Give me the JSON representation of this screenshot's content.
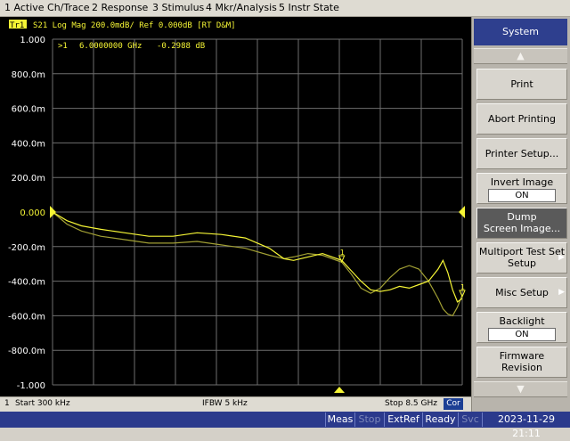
{
  "menu": {
    "items": [
      "1 Active Ch/Trace",
      "2 Response",
      "3 Stimulus",
      "4 Mkr/Analysis",
      "5 Instr State"
    ]
  },
  "trace_header": {
    "trace_badge": "Tr1",
    "text": "S21 Log Mag 200.0mdB/ Ref 0.000dB [RT D&M]"
  },
  "marker_readout": {
    "marker": ">1",
    "frequency": "6.0000000 GHz",
    "value": "-0.2988 dB"
  },
  "chart_data": {
    "type": "line",
    "title": "",
    "xlabel": "",
    "ylabel": "",
    "x_unit": "GHz",
    "xlim": [
      0.0003,
      8.5
    ],
    "ylim": [
      -1.0,
      1.0
    ],
    "y_unit": "dB",
    "grid": true,
    "y_tick_labels": [
      "1.000",
      "800.0m",
      "600.0m",
      "400.0m",
      "200.0m",
      "0.000",
      "-200.0m",
      "-400.0m",
      "-600.0m",
      "-800.0m",
      "-1.000"
    ],
    "y_ticks": [
      1.0,
      0.8,
      0.6,
      0.4,
      0.2,
      0.0,
      -0.2,
      -0.4,
      -0.6,
      -0.8,
      -1.0
    ],
    "reference_level": 0.0,
    "series": [
      {
        "color": "#f5f535",
        "x": [
          0.0003,
          0.3,
          0.6,
          1.0,
          1.5,
          2.0,
          2.5,
          3.0,
          3.5,
          4.0,
          4.5,
          4.8,
          5.0,
          5.3,
          5.6,
          6.0,
          6.2,
          6.4,
          6.6,
          6.8,
          7.0,
          7.2,
          7.4,
          7.6,
          7.8,
          8.0,
          8.1,
          8.2,
          8.3,
          8.4,
          8.5
        ],
        "y": [
          0.0,
          -0.05,
          -0.08,
          -0.1,
          -0.12,
          -0.14,
          -0.14,
          -0.12,
          -0.13,
          -0.15,
          -0.21,
          -0.27,
          -0.28,
          -0.26,
          -0.24,
          -0.28,
          -0.34,
          -0.4,
          -0.45,
          -0.46,
          -0.45,
          -0.43,
          -0.44,
          -0.42,
          -0.4,
          -0.33,
          -0.28,
          -0.35,
          -0.45,
          -0.52,
          -0.5
        ]
      },
      {
        "color": "#a2a034",
        "x": [
          0.0003,
          0.3,
          0.6,
          1.0,
          1.5,
          2.0,
          2.5,
          3.0,
          3.5,
          4.0,
          4.5,
          4.8,
          5.0,
          5.3,
          5.6,
          6.0,
          6.2,
          6.4,
          6.6,
          6.8,
          7.0,
          7.2,
          7.4,
          7.6,
          7.8,
          8.0,
          8.1,
          8.2,
          8.3,
          8.4,
          8.5
        ],
        "y": [
          0.0,
          -0.07,
          -0.11,
          -0.14,
          -0.16,
          -0.18,
          -0.18,
          -0.17,
          -0.19,
          -0.21,
          -0.25,
          -0.27,
          -0.26,
          -0.24,
          -0.25,
          -0.29,
          -0.36,
          -0.44,
          -0.47,
          -0.44,
          -0.38,
          -0.33,
          -0.31,
          -0.33,
          -0.4,
          -0.5,
          -0.56,
          -0.59,
          -0.6,
          -0.55,
          -0.48
        ]
      }
    ],
    "markers": [
      {
        "label": "1",
        "x": 6.0,
        "y": -0.2988
      },
      {
        "label": "1",
        "x": 8.5,
        "y": -0.5
      }
    ]
  },
  "stimulus": {
    "channel": "1",
    "start": "Start 300 kHz",
    "ifbw": "IFBW 5 kHz",
    "stop": "Stop 8.5 GHz",
    "cor": "Cor"
  },
  "status": {
    "meas": "Meas",
    "stop": "Stop",
    "extref": "ExtRef",
    "ready": "Ready",
    "svc": "Svc",
    "datetime": "2023-11-29 21:11"
  },
  "softkeys": {
    "title": "System",
    "print": "Print",
    "abort_printing": "Abort Printing",
    "printer_setup": "Printer Setup...",
    "invert_image": "Invert Image",
    "invert_image_state": "ON",
    "dump_line1": "Dump",
    "dump_line2": "Screen Image...",
    "multiport_line1": "Multiport Test Set",
    "multiport_line2": "Setup",
    "misc_setup": "Misc Setup",
    "backlight": "Backlight",
    "backlight_state": "ON",
    "firmware_line1": "Firmware",
    "firmware_line2": "Revision"
  },
  "colors": {
    "trace_primary": "#f5f535",
    "trace_memory": "#a2a034",
    "grid": "#6e6e6e",
    "axis_text": "#ffffff",
    "status_bar": "#2b3a8c"
  },
  "icons": [
    "scroll-up-arrow-icon",
    "scroll-down-arrow-icon",
    "submenu-chevron-icon",
    "marker-triangle-icon",
    "reference-triangle-icon"
  ]
}
